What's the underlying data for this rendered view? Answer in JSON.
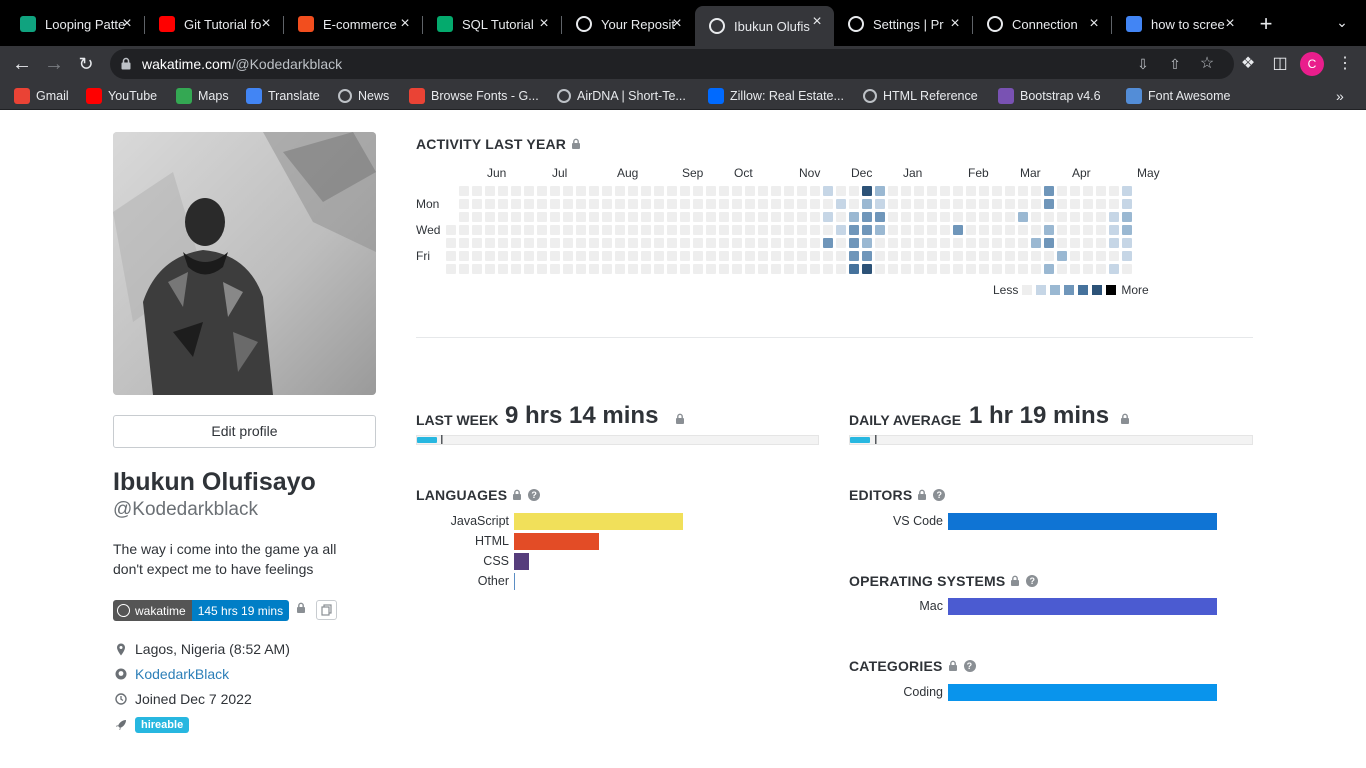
{
  "browser": {
    "tabs": [
      {
        "label": "Looping Patte",
        "icon": "chatgpt-icon",
        "color": "#10a37f"
      },
      {
        "label": "Git Tutorial fo",
        "icon": "youtube-icon",
        "color": "#ff0000"
      },
      {
        "label": "E-commerce",
        "icon": "figma-icon",
        "color": "#f24e1e"
      },
      {
        "label": "SQL Tutorial",
        "icon": "w3schools-icon",
        "color": "#04aa6d"
      },
      {
        "label": "Your Reposit",
        "icon": "github-icon",
        "color": "#ffffff"
      },
      {
        "label": "Ibukun Olufis",
        "icon": "wakatime-icon",
        "color": "#ffffff"
      },
      {
        "label": "Settings | Pr",
        "icon": "settings-icon",
        "color": "#ffffff"
      },
      {
        "label": "Connection",
        "icon": "github-icon",
        "color": "#ffffff"
      },
      {
        "label": "how to scree",
        "icon": "google-icon",
        "color": "#4285f4"
      }
    ],
    "active_tab": 5,
    "url_host": "wakatime.com",
    "url_path": "/@Kodedarkblack",
    "profile_initial": "C",
    "bookmarks": [
      {
        "label": "Gmail",
        "icon": "gmail-icon",
        "color": "#ea4335"
      },
      {
        "label": "YouTube",
        "icon": "youtube-icon",
        "color": "#ff0000"
      },
      {
        "label": "Maps",
        "icon": "maps-icon",
        "color": "#34a853"
      },
      {
        "label": "Translate",
        "icon": "translate-icon",
        "color": "#4285f4"
      },
      {
        "label": "News",
        "icon": "globe-icon",
        "color": "#bdc1c6"
      },
      {
        "label": "Browse Fonts - G...",
        "icon": "google-fonts-icon",
        "color": "#ea4335"
      },
      {
        "label": "AirDNA | Short-Te...",
        "icon": "globe-icon",
        "color": "#bdc1c6"
      },
      {
        "label": "Zillow: Real Estate...",
        "icon": "zillow-icon",
        "color": "#006aff"
      },
      {
        "label": "HTML Reference",
        "icon": "globe-icon",
        "color": "#bdc1c6"
      },
      {
        "label": "Bootstrap v4.6",
        "icon": "bootstrap-icon",
        "color": "#7952b3"
      },
      {
        "label": "Font Awesome",
        "icon": "flag-icon",
        "color": "#538dd7"
      }
    ]
  },
  "profile": {
    "edit_label": "Edit profile",
    "name": "Ibukun Olufisayo",
    "handle": "@Kodedarkblack",
    "bio": "The way i come into the game ya all don't expect me to have feelings",
    "badge_left": "wakatime",
    "badge_right": "145 hrs 19 mins",
    "location": "Lagos, Nigeria (8:52 AM)",
    "github": "KodedarkBlack",
    "joined": "Joined Dec 7 2022",
    "hireable": "hireable"
  },
  "activity": {
    "title": "ACTIVITY LAST YEAR",
    "months": [
      "Jun",
      "Jul",
      "Aug",
      "Sep",
      "Oct",
      "Nov",
      "Dec",
      "Jan",
      "Feb",
      "Mar",
      "Apr",
      "May"
    ],
    "days": [
      "Mon",
      "Wed",
      "Fri"
    ],
    "legend_less": "Less",
    "legend_more": "More",
    "levels": [
      "#eeeeee",
      "#c6d6e6",
      "#9ab8d2",
      "#6f96ba",
      "#45729c",
      "#2c5277",
      "#000000"
    ]
  },
  "stats": {
    "last_week_label": "LAST WEEK",
    "last_week_value": "9 hrs 14 mins",
    "last_week_progress": 0.05,
    "daily_avg_label": "DAILY AVERAGE",
    "daily_avg_value": "1 hr 19 mins",
    "daily_avg_progress": 0.05
  },
  "languages": {
    "title": "LANGUAGES",
    "items": [
      {
        "label": "JavaScript",
        "fraction": 1.0,
        "color": "#f1e05a"
      },
      {
        "label": "HTML",
        "fraction": 0.5,
        "color": "#e34c26"
      },
      {
        "label": "CSS",
        "fraction": 0.09,
        "color": "#563d7c"
      },
      {
        "label": "Other",
        "fraction": 0.006,
        "color": "#5b8ec4"
      }
    ]
  },
  "editors": {
    "title": "EDITORS",
    "items": [
      {
        "label": "VS Code",
        "fraction": 1.0,
        "color": "#0f74d4"
      }
    ]
  },
  "os": {
    "title": "OPERATING SYSTEMS",
    "items": [
      {
        "label": "Mac",
        "fraction": 1.0,
        "color": "#4b5bd1"
      }
    ]
  },
  "categories": {
    "title": "CATEGORIES",
    "items": [
      {
        "label": "Coding",
        "fraction": 1.0,
        "color": "#0994ec"
      }
    ]
  }
}
